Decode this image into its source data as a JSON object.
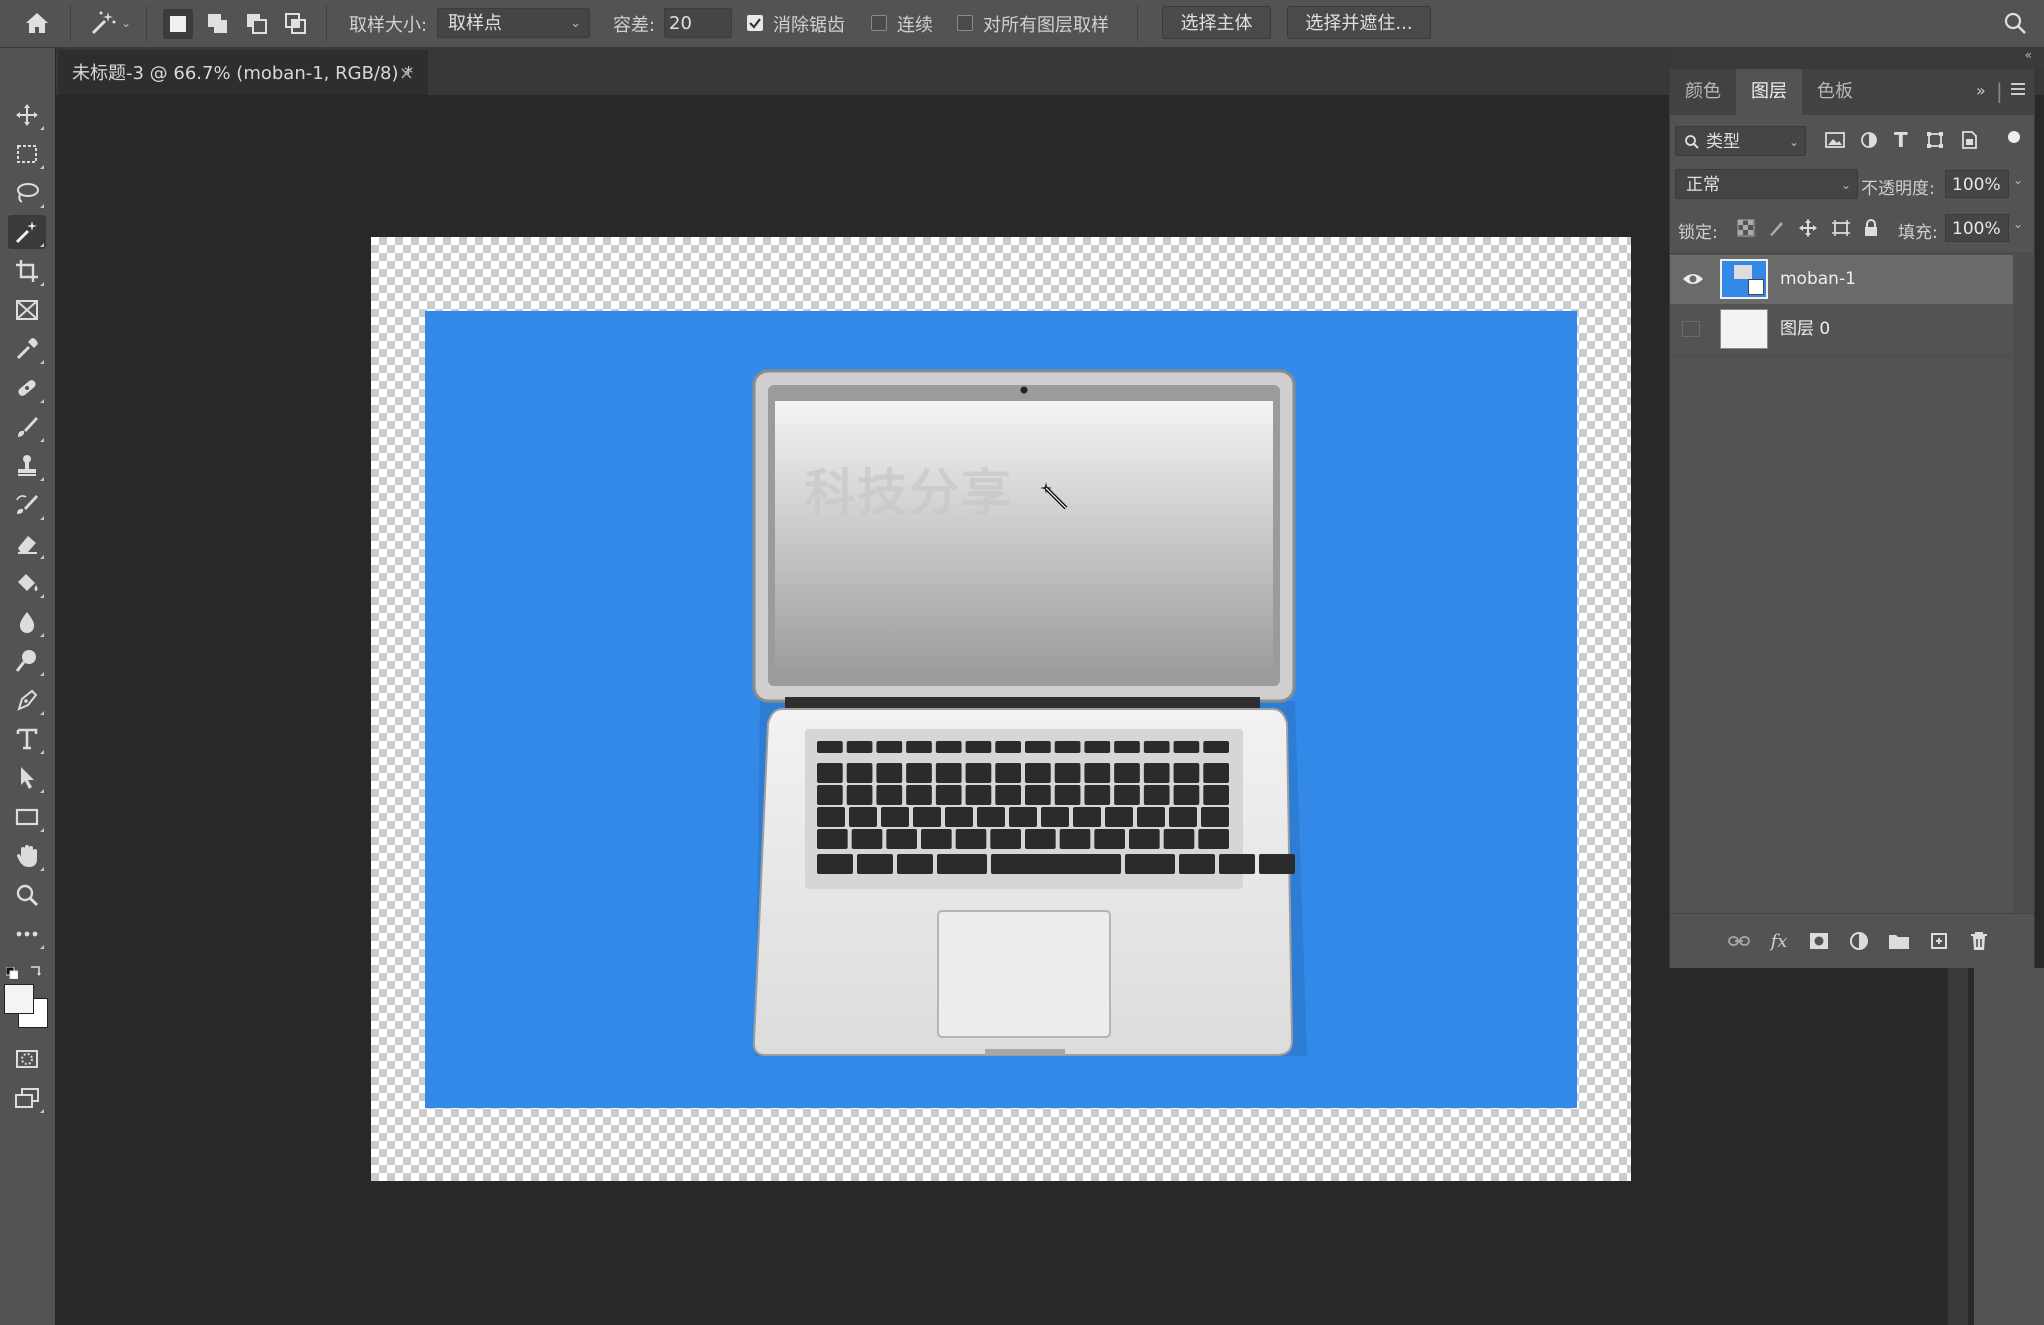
{
  "options_bar": {
    "sample_size_label": "取样大小:",
    "sample_size_value": "取样点",
    "tolerance_label": "容差:",
    "tolerance_value": "20",
    "antialias_label": "消除锯齿",
    "antialias_checked": true,
    "contiguous_label": "连续",
    "contiguous_checked": false,
    "sample_all_layers_label": "对所有图层取样",
    "sample_all_layers_checked": false,
    "select_subject_label": "选择主体",
    "select_and_mask_label": "选择并遮住..."
  },
  "document_tab": {
    "title": "未标题-3 @ 66.7% (moban-1, RGB/8) *",
    "close_glyph": "×"
  },
  "canvas": {
    "photo_background_color": "#3289e8",
    "screen_watermark_text": "科技分享"
  },
  "panel": {
    "tabs": [
      "颜色",
      "图层",
      "色板"
    ],
    "active_tab": "图层",
    "filter_kind_label": "类型",
    "blend_mode": "正常",
    "opacity_label": "不透明度:",
    "opacity_value": "100%",
    "lock_label": "锁定:",
    "fill_label": "填充:",
    "fill_value": "100%",
    "layers": [
      {
        "name": "moban-1",
        "visible": true,
        "selected": true
      },
      {
        "name": "图层 0",
        "visible": false,
        "selected": false
      }
    ]
  },
  "tools": [
    {
      "name": "move-tool",
      "active": false
    },
    {
      "name": "marquee-tool",
      "active": false
    },
    {
      "name": "lasso-tool",
      "active": false
    },
    {
      "name": "magic-wand-tool",
      "active": true
    },
    {
      "name": "crop-tool",
      "active": false
    },
    {
      "name": "frame-tool",
      "active": false
    },
    {
      "name": "eyedropper-tool",
      "active": false
    },
    {
      "name": "healing-brush-tool",
      "active": false
    },
    {
      "name": "brush-tool",
      "active": false
    },
    {
      "name": "clone-stamp-tool",
      "active": false
    },
    {
      "name": "history-brush-tool",
      "active": false
    },
    {
      "name": "eraser-tool",
      "active": false
    },
    {
      "name": "paint-bucket-tool",
      "active": false
    },
    {
      "name": "blur-tool",
      "active": false
    },
    {
      "name": "dodge-tool",
      "active": false
    },
    {
      "name": "pen-tool",
      "active": false
    },
    {
      "name": "type-tool",
      "active": false
    },
    {
      "name": "path-selection-tool",
      "active": false
    },
    {
      "name": "rectangle-tool",
      "active": false
    },
    {
      "name": "hand-tool",
      "active": false
    },
    {
      "name": "zoom-tool",
      "active": false
    },
    {
      "name": "more-tools",
      "active": false
    }
  ],
  "colors": {
    "ui_panel": "#535353",
    "ui_dark": "#282828",
    "selected_layer": "#6a6a6a",
    "photo_blue": "#3289e8"
  }
}
